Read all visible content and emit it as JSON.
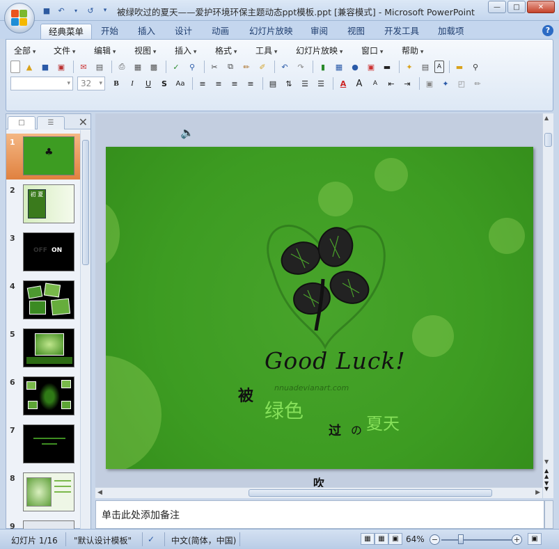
{
  "window": {
    "title": "被绿吹过的夏天——爱护环境环保主题动态ppt模板.ppt [兼容模式] - Microsoft PowerPoint"
  },
  "ribbon_tabs": [
    "经典菜单",
    "开始",
    "插入",
    "设计",
    "动画",
    "幻灯片放映",
    "审阅",
    "视图",
    "开发工具",
    "加载项"
  ],
  "menus": [
    "全部",
    "文件",
    "编辑",
    "视图",
    "插入",
    "格式",
    "工具",
    "幻灯片放映",
    "窗口",
    "帮助"
  ],
  "font_size_combo": "32",
  "slide_thumbnails": [
    "1",
    "2",
    "3",
    "4",
    "5",
    "6",
    "7",
    "8",
    "9"
  ],
  "slide": {
    "good_luck": "Good Luck!",
    "watermark": "nnuadevianart.com",
    "char_bei": "被",
    "lu_se": "绿色",
    "char_guo": "过",
    "char_no": "の",
    "xia_tian": "夏天",
    "char_chui": "吹",
    "thumb3_off": "OFF",
    "thumb3_on": "ON",
    "thumb2_text": "初 夏"
  },
  "notes_placeholder": "单击此处添加备注",
  "statusbar": {
    "slide_counter": "幻灯片 1/16",
    "theme": "\"默认设计模板\"",
    "language": "中文(简体，中国)",
    "zoom": "64%"
  },
  "colors": {
    "slide_green": "#3d9c22",
    "accent_orange": "#e0813f",
    "ribbon_blue": "#c4d6ee"
  }
}
